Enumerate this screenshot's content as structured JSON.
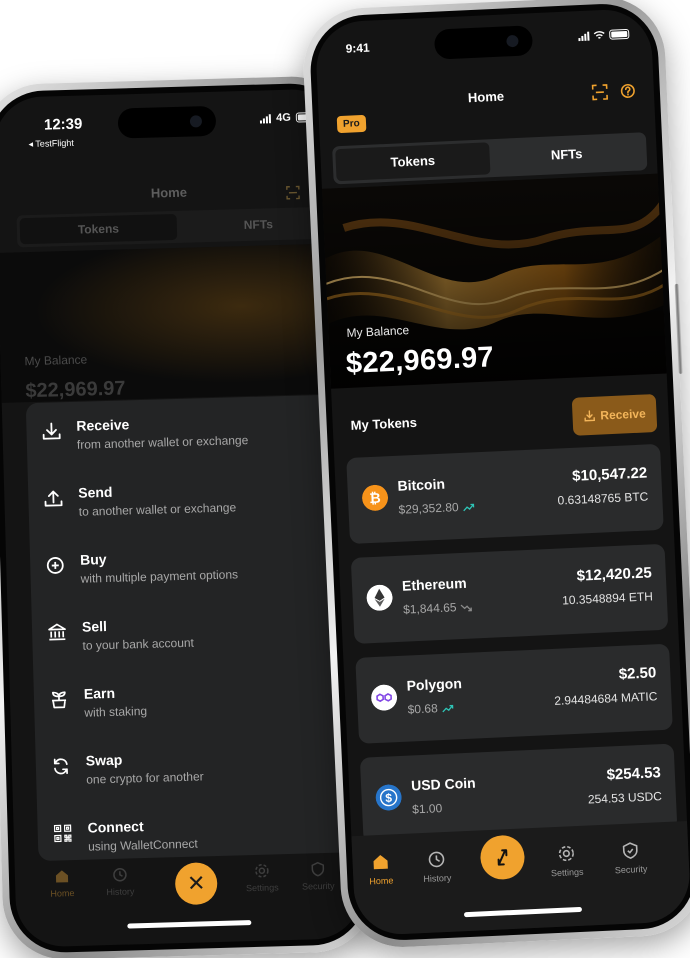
{
  "colors": {
    "accent": "#f0a22e",
    "card": "#2a2b2c",
    "background": "#141414",
    "positive": "#2ec4b6"
  },
  "left_phone": {
    "status": {
      "time": "12:39",
      "back_app": "◂ TestFlight",
      "network": "4G"
    },
    "header": {
      "title": "Home"
    },
    "tabs": [
      {
        "label": "Tokens"
      },
      {
        "label": "NFTs"
      }
    ],
    "balance": {
      "label": "My Balance",
      "value": "$22,969.97"
    },
    "action_menu": [
      {
        "title": "Receive",
        "desc": "from another wallet or exchange",
        "icon": "download-icon"
      },
      {
        "title": "Send",
        "desc": "to another wallet or exchange",
        "icon": "upload-icon"
      },
      {
        "title": "Buy",
        "desc": "with multiple payment options",
        "icon": "plus-circle-icon"
      },
      {
        "title": "Sell",
        "desc": "to your bank account",
        "icon": "bank-icon"
      },
      {
        "title": "Earn",
        "desc": "with staking",
        "icon": "plant-icon"
      },
      {
        "title": "Swap",
        "desc": "one crypto for another",
        "icon": "swap-icon"
      },
      {
        "title": "Connect",
        "desc": "using WalletConnect",
        "icon": "qr-icon"
      }
    ],
    "tabbar": [
      {
        "label": "Home"
      },
      {
        "label": "History"
      },
      {
        "label": "Settings"
      },
      {
        "label": "Security"
      }
    ],
    "close_label": "✕"
  },
  "right_phone": {
    "status": {
      "time": "9:41"
    },
    "header": {
      "title": "Home",
      "badge": "Pro"
    },
    "tabs": [
      {
        "label": "Tokens"
      },
      {
        "label": "NFTs"
      }
    ],
    "balance": {
      "label": "My Balance",
      "value": "$22,969.97"
    },
    "tokens_section": {
      "heading": "My Tokens",
      "receive_label": "Receive"
    },
    "tokens": [
      {
        "name": "Bitcoin",
        "price": "$29,352.80",
        "trend": "up",
        "value": "$10,547.22",
        "amount": "0.63148765 BTC",
        "icon": "bitcoin-icon",
        "color": "#f7931a"
      },
      {
        "name": "Ethereum",
        "price": "$1,844.65",
        "trend": "down",
        "value": "$12,420.25",
        "amount": "10.3548894 ETH",
        "icon": "ethereum-icon",
        "color": "#ffffff"
      },
      {
        "name": "Polygon",
        "price": "$0.68",
        "trend": "up",
        "value": "$2.50",
        "amount": "2.94484684 MATIC",
        "icon": "polygon-icon",
        "color": "#ffffff"
      },
      {
        "name": "USD Coin",
        "price": "$1.00",
        "trend": "none",
        "value": "$254.53",
        "amount": "254.53 USDC",
        "icon": "usdc-icon",
        "color": "#2775ca"
      }
    ],
    "tabbar": [
      {
        "label": "Home"
      },
      {
        "label": "History"
      },
      {
        "label": "Settings"
      },
      {
        "label": "Security"
      }
    ]
  }
}
